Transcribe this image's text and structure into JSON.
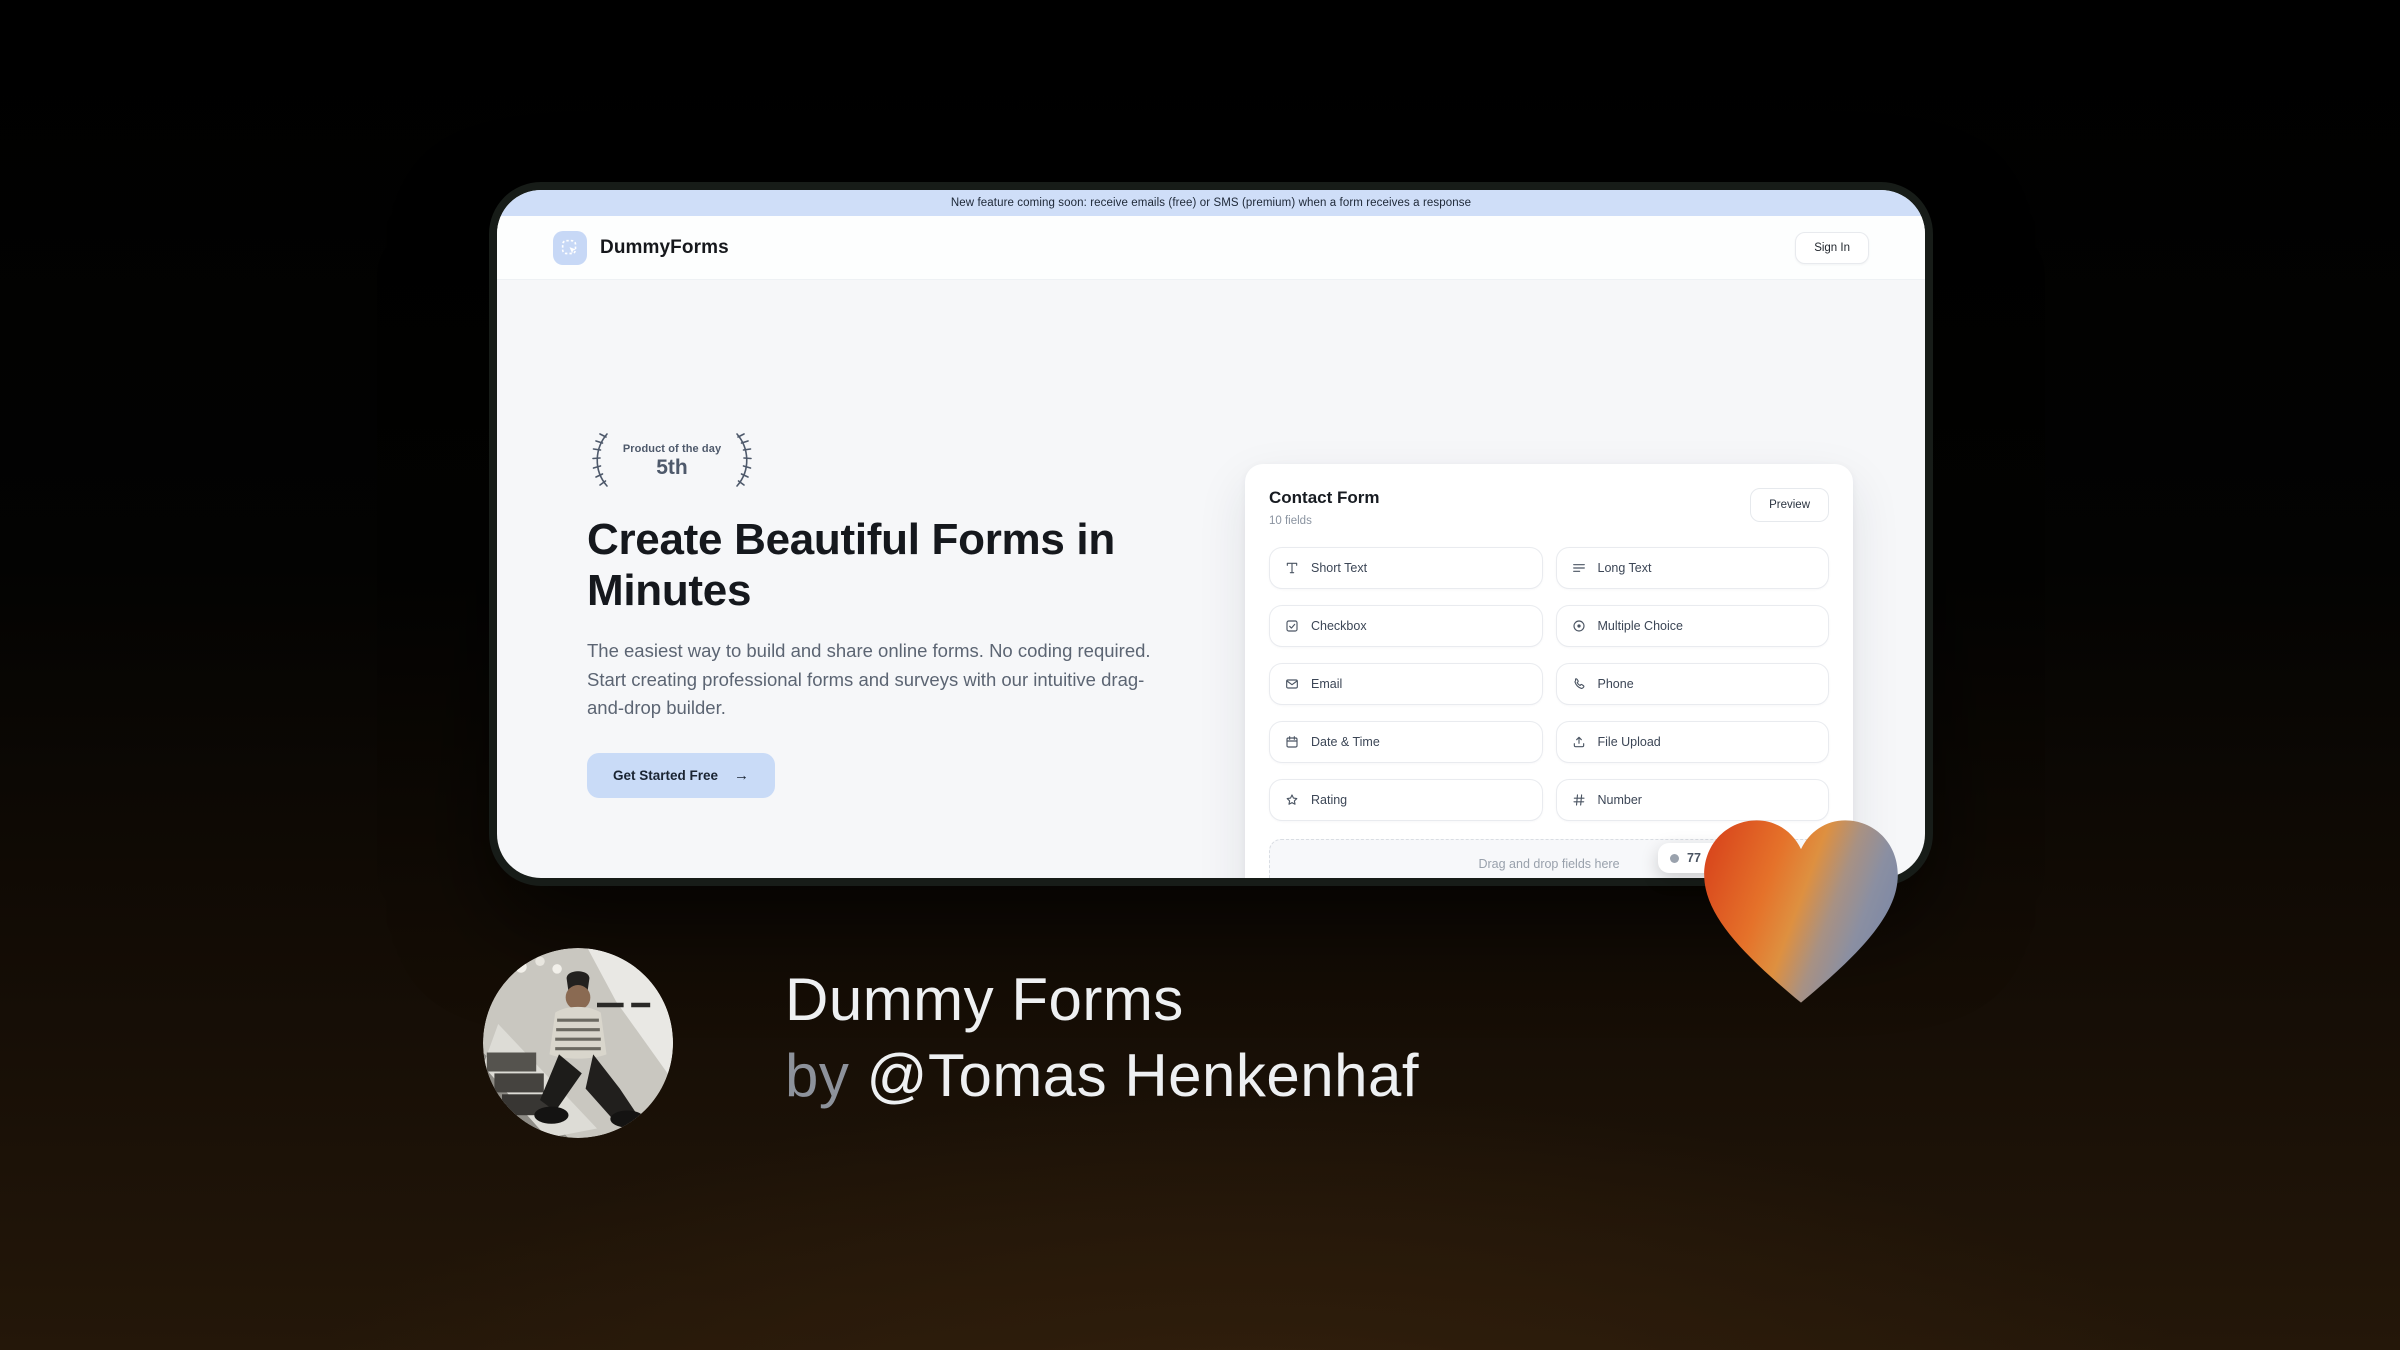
{
  "banner": {
    "text": "New feature coming soon: receive emails (free) or SMS (premium) when a form receives a response"
  },
  "header": {
    "brand": "DummyForms",
    "sign_in_label": "Sign In"
  },
  "hero": {
    "award": {
      "line1": "Product of the day",
      "line2": "5th"
    },
    "title_line1": "Create Beautiful Forms in",
    "title_line2": "Minutes",
    "description": "The easiest way to build and share online forms. No coding required. Start creating professional forms and surveys with our intuitive drag-and-drop builder.",
    "cta_label": "Get Started Free",
    "cta_arrow": "→"
  },
  "form_card": {
    "title": "Contact Form",
    "subtitle": "10 fields",
    "preview_label": "Preview",
    "fields": [
      {
        "label": "Short Text",
        "icon": "short-text-icon"
      },
      {
        "label": "Long Text",
        "icon": "long-text-icon"
      },
      {
        "label": "Checkbox",
        "icon": "checkbox-icon"
      },
      {
        "label": "Multiple Choice",
        "icon": "radio-icon"
      },
      {
        "label": "Email",
        "icon": "email-icon"
      },
      {
        "label": "Phone",
        "icon": "phone-icon"
      },
      {
        "label": "Date & Time",
        "icon": "calendar-icon"
      },
      {
        "label": "File Upload",
        "icon": "upload-icon"
      },
      {
        "label": "Rating",
        "icon": "star-icon"
      },
      {
        "label": "Number",
        "icon": "hash-icon"
      }
    ],
    "dropzone_text": "Drag and drop fields here"
  },
  "vote_badge": {
    "count": "77"
  },
  "caption": {
    "line1": "Dummy Forms",
    "by_label": "by ",
    "author": "@Tomas Henkenhaf"
  },
  "colors": {
    "banner_bg": "#cfdef8",
    "accent_blue": "#c9dbf7",
    "logo_blue": "#c7d8f6",
    "hero_bg": "#f6f7f9",
    "heart_orange": "#e04a1b",
    "heart_gray_blue": "#7b87a6",
    "bg_brown": "#241709"
  }
}
